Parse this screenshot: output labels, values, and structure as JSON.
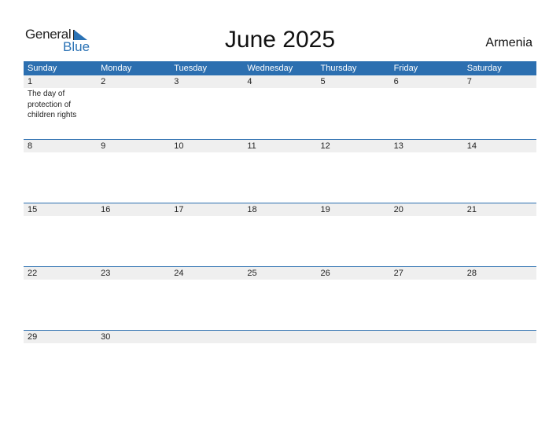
{
  "logo": {
    "word1": "General",
    "word2": "Blue"
  },
  "title": "June 2025",
  "country": "Armenia",
  "colors": {
    "accent": "#2c6fb0",
    "row_bg": "#efefef"
  },
  "weekdays": [
    "Sunday",
    "Monday",
    "Tuesday",
    "Wednesday",
    "Thursday",
    "Friday",
    "Saturday"
  ],
  "weeks": [
    {
      "days": [
        "1",
        "2",
        "3",
        "4",
        "5",
        "6",
        "7"
      ],
      "events": [
        "The day of protection of children rights",
        "",
        "",
        "",
        "",
        "",
        ""
      ]
    },
    {
      "days": [
        "8",
        "9",
        "10",
        "11",
        "12",
        "13",
        "14"
      ],
      "events": [
        "",
        "",
        "",
        "",
        "",
        "",
        ""
      ]
    },
    {
      "days": [
        "15",
        "16",
        "17",
        "18",
        "19",
        "20",
        "21"
      ],
      "events": [
        "",
        "",
        "",
        "",
        "",
        "",
        ""
      ]
    },
    {
      "days": [
        "22",
        "23",
        "24",
        "25",
        "26",
        "27",
        "28"
      ],
      "events": [
        "",
        "",
        "",
        "",
        "",
        "",
        ""
      ]
    },
    {
      "days": [
        "29",
        "30",
        "",
        "",
        "",
        "",
        ""
      ],
      "events": [
        "",
        "",
        "",
        "",
        "",
        "",
        ""
      ]
    }
  ]
}
